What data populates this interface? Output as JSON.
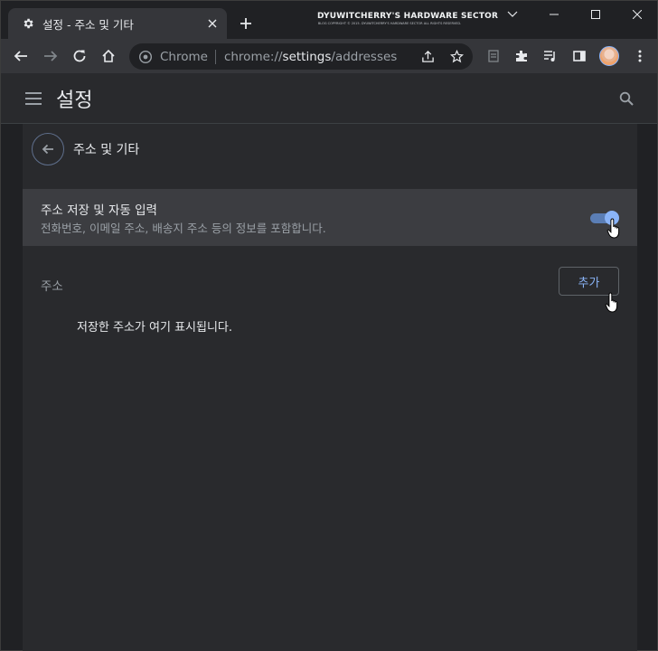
{
  "browser": {
    "tab": {
      "title": "설정 - 주소 및 기타",
      "icon": "gear-icon"
    },
    "banner": {
      "title": "DYUWITCHERRY'S HARDWARE SECTOR",
      "subtitle": "BLOG COPYRIGHT © 2015. DYUWITCHERRY'S HARDWARE SECTOR ALL RIGHTS RESERVED."
    },
    "omnibox": {
      "chip": "Chrome",
      "url_scheme": "chrome://",
      "url_host": "settings",
      "url_path": "/addresses"
    }
  },
  "settings": {
    "header_title": "설정",
    "page_subtitle": "주소 및 기타",
    "autofill": {
      "title": "주소 저장 및 자동 입력",
      "description": "전화번호, 이메일 주소, 배송지 주소 등의 정보를 포함합니다.",
      "enabled": true
    },
    "addresses": {
      "section_label": "주소",
      "add_label": "추가",
      "empty_message": "저장한 주소가 여기 표시됩니다."
    }
  },
  "colors": {
    "accent": "#8ab4f8",
    "background": "#202124",
    "card": "#292a2d",
    "toolbar": "#35363a"
  }
}
